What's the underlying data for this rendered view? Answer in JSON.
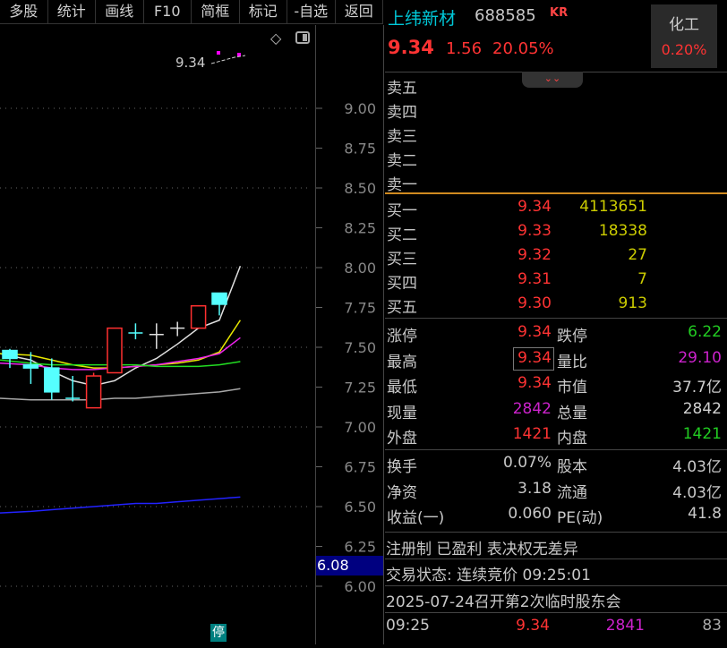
{
  "toolbar": {
    "items": [
      "多股",
      "统计",
      "画线",
      "F10",
      "简框",
      "标记",
      "-自选",
      "返回"
    ]
  },
  "chart_data": {
    "type": "candlestick",
    "ylim": [
      5.8,
      9.35
    ],
    "y_ticks": [
      "9.00",
      "8.75",
      "8.50",
      "8.25",
      "8.00",
      "7.75",
      "7.50",
      "7.25",
      "7.00",
      "6.75",
      "6.50",
      "6.25",
      "6.00"
    ],
    "candles": [
      {
        "o": 7.48,
        "c": 7.43,
        "h": 7.49,
        "l": 7.37
      },
      {
        "o": 7.39,
        "c": 7.37,
        "h": 7.47,
        "l": 7.27
      },
      {
        "o": 7.37,
        "c": 7.22,
        "h": 7.43,
        "l": 7.17
      },
      {
        "o": 7.18,
        "c": 7.18,
        "h": 7.32,
        "l": 7.16
      },
      {
        "o": 7.12,
        "c": 7.32,
        "h": 7.34,
        "l": 7.12
      },
      {
        "o": 7.34,
        "c": 7.62,
        "h": 7.62,
        "l": 7.34
      },
      {
        "o": 7.59,
        "c": 7.59,
        "h": 7.65,
        "l": 7.55
      },
      {
        "o": 7.58,
        "c": 7.58,
        "h": 7.65,
        "l": 7.49
      },
      {
        "o": 7.62,
        "c": 7.62,
        "h": 7.66,
        "l": 7.57
      },
      {
        "o": 7.62,
        "c": 7.76,
        "h": 7.76,
        "l": 7.62
      },
      {
        "o": 7.84,
        "c": 7.77,
        "h": 7.84,
        "l": 7.7
      }
    ],
    "ma_lines": [
      {
        "color": "#e0e0e0",
        "values": [
          7.46,
          7.42,
          7.35,
          7.29,
          7.26,
          7.29,
          7.37,
          7.43,
          7.52,
          7.62,
          7.67,
          8.01
        ]
      },
      {
        "color": "#e8e800",
        "values": [
          7.46,
          7.45,
          7.42,
          7.39,
          7.37,
          7.37,
          7.38,
          7.39,
          7.4,
          7.42,
          7.47,
          7.67
        ]
      },
      {
        "color": "#ee22ee",
        "values": [
          7.4,
          7.39,
          7.37,
          7.36,
          7.36,
          7.37,
          7.38,
          7.39,
          7.41,
          7.43,
          7.46,
          7.56
        ]
      },
      {
        "color": "#22dd22",
        "values": [
          7.42,
          7.4,
          7.39,
          7.39,
          7.39,
          7.39,
          7.39,
          7.38,
          7.38,
          7.38,
          7.39,
          7.41
        ]
      },
      {
        "color": "#a8a8a8",
        "values": [
          7.18,
          7.17,
          7.17,
          7.17,
          7.17,
          7.18,
          7.18,
          7.19,
          7.2,
          7.21,
          7.22,
          7.24
        ]
      },
      {
        "color": "#2222ff",
        "values": [
          6.46,
          6.47,
          6.48,
          6.49,
          6.5,
          6.51,
          6.52,
          6.52,
          6.53,
          6.54,
          6.55,
          6.56
        ]
      }
    ],
    "last_price_label": "9.34",
    "current_tag": "6.08",
    "limit_badge": "停"
  },
  "stock": {
    "name": "上纬新材",
    "code": "688585",
    "tag": "KR",
    "price": "9.34",
    "change": "1.56",
    "pct": "20.05%",
    "sector": "化工",
    "sector_pct": "0.20%"
  },
  "asks": [
    {
      "label": "卖五"
    },
    {
      "label": "卖四"
    },
    {
      "label": "卖三"
    },
    {
      "label": "卖二"
    },
    {
      "label": "卖一"
    }
  ],
  "bids": [
    {
      "label": "买一",
      "price": "9.34",
      "vol": "4113651"
    },
    {
      "label": "买二",
      "price": "9.33",
      "vol": "18338"
    },
    {
      "label": "买三",
      "price": "9.32",
      "vol": "27"
    },
    {
      "label": "买四",
      "price": "9.31",
      "vol": "7"
    },
    {
      "label": "买五",
      "price": "9.30",
      "vol": "913"
    }
  ],
  "stats": [
    {
      "l1": "涨停",
      "v1": "9.34",
      "c1": "red",
      "l2": "跌停",
      "v2": "6.22",
      "c2": "green"
    },
    {
      "l1": "最高",
      "v1": "9.34",
      "c1": "red",
      "l2": "量比",
      "v2": "29.10",
      "c2": "purple"
    },
    {
      "l1": "最低",
      "v1": "9.34",
      "c1": "red",
      "l2": "市值",
      "v2": "37.7亿",
      "c2": "white"
    },
    {
      "l1": "现量",
      "v1": "2842",
      "c1": "purple",
      "l2": "总量",
      "v2": "2842",
      "c2": "white"
    },
    {
      "l1": "外盘",
      "v1": "1421",
      "c1": "red",
      "l2": "内盘",
      "v2": "1421",
      "c2": "green"
    }
  ],
  "fundamentals": [
    {
      "l1": "换手",
      "v1": "0.07%",
      "l2": "股本",
      "v2": "4.03亿"
    },
    {
      "l1": "净资",
      "v1": "3.18",
      "l2": "流通",
      "v2": "4.03亿"
    },
    {
      "l1": "收益(一)",
      "v1": "0.060",
      "l2": "PE(动)",
      "v2": "41.8"
    }
  ],
  "info": {
    "line1": "注册制 已盈利 表决权无差异",
    "line2": "交易状态: 连续竞价 09:25:01",
    "line3": "2025-07-24召开第2次临时股东会"
  },
  "tick": {
    "time": "09:25",
    "price": "9.34",
    "vol": "2841",
    "count": "83"
  }
}
